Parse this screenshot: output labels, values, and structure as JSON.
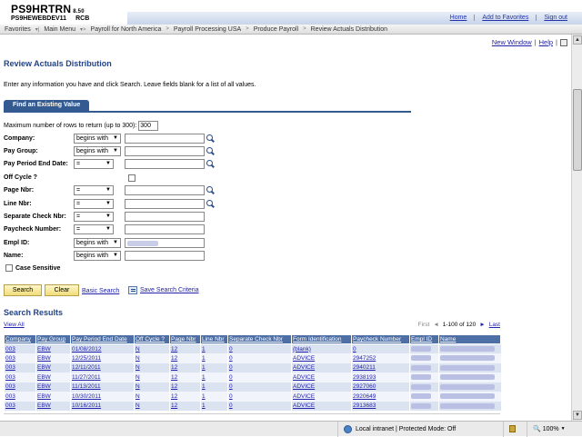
{
  "header": {
    "app_title": "PS9HRTRN",
    "version": "8.50",
    "server": "PS9HEWEBDEV11",
    "user": "RCB",
    "links": [
      "Home",
      "Add to Favorites",
      "Sign out"
    ]
  },
  "nav": {
    "items": [
      "Favorites",
      "Main Menu",
      "Payroll for North America",
      "Payroll Processing USA",
      "Produce Payroll",
      "Review Actuals Distribution"
    ]
  },
  "util": {
    "new_window": "New Window",
    "help": "Help"
  },
  "page": {
    "title": "Review Actuals Distribution",
    "instructions": "Enter any information you have and click Search. Leave fields blank for a list of all values.",
    "tab_label": "Find an Existing Value"
  },
  "search": {
    "max_rows_label": "Maximum number of rows to return (up to 300):",
    "max_rows_value": "300",
    "fields": [
      {
        "label": "Company:",
        "op": "begins with",
        "lookup": true
      },
      {
        "label": "Pay Group:",
        "op": "begins with",
        "lookup": true
      },
      {
        "label": "Pay Period End Date:",
        "op": "=",
        "lookup": true
      },
      {
        "label": "Off Cycle ?",
        "op": "",
        "checkbox": true
      },
      {
        "label": "Page Nbr:",
        "op": "=",
        "lookup": true
      },
      {
        "label": "Line Nbr:",
        "op": "=",
        "lookup": true
      },
      {
        "label": "Separate Check Nbr:",
        "op": "=",
        "lookup": false
      },
      {
        "label": "Paycheck Number:",
        "op": "=",
        "lookup": false
      },
      {
        "label": "Empl ID:",
        "op": "begins with",
        "lookup": false,
        "redacted": true
      },
      {
        "label": "Name:",
        "op": "begins with",
        "lookup": false
      }
    ],
    "case_sensitive_label": "Case Sensitive",
    "search_button": "Search",
    "clear_button": "Clear",
    "basic_search": "Basic Search",
    "save_criteria": "Save Search Criteria"
  },
  "results": {
    "title": "Search Results",
    "view_all": "View All",
    "first": "First",
    "range": "1-100 of 120",
    "last": "Last",
    "columns": [
      "Company",
      "Pay Group",
      "Pay Period End Date",
      "Off Cycle ?",
      "Page Nbr",
      "Line Nbr",
      "Separate Check Nbr",
      "Form Identification",
      "Paycheck Number",
      "Empl ID",
      "Name"
    ],
    "rows": [
      [
        "003",
        "EBW",
        "01/08/2012",
        "N",
        "12",
        "1",
        "0",
        "(blank)",
        "0"
      ],
      [
        "003",
        "EBW",
        "12/25/2011",
        "N",
        "12",
        "1",
        "0",
        "ADVICE",
        "2947252"
      ],
      [
        "003",
        "EBW",
        "12/11/2011",
        "N",
        "12",
        "1",
        "0",
        "ADVICE",
        "2940211"
      ],
      [
        "003",
        "EBW",
        "11/27/2011",
        "N",
        "12",
        "1",
        "0",
        "ADVICE",
        "2938193"
      ],
      [
        "003",
        "EBW",
        "11/13/2011",
        "N",
        "12",
        "1",
        "0",
        "ADVICE",
        "2927060"
      ],
      [
        "003",
        "EBW",
        "10/30/2011",
        "N",
        "12",
        "1",
        "0",
        "ADVICE",
        "2920649"
      ],
      [
        "003",
        "EBW",
        "10/16/2011",
        "N",
        "12",
        "1",
        "0",
        "ADVICE",
        "2913683"
      ]
    ]
  },
  "statusbar": {
    "zone": "Local intranet | Protected Mode: Off",
    "zoom": "100%"
  }
}
